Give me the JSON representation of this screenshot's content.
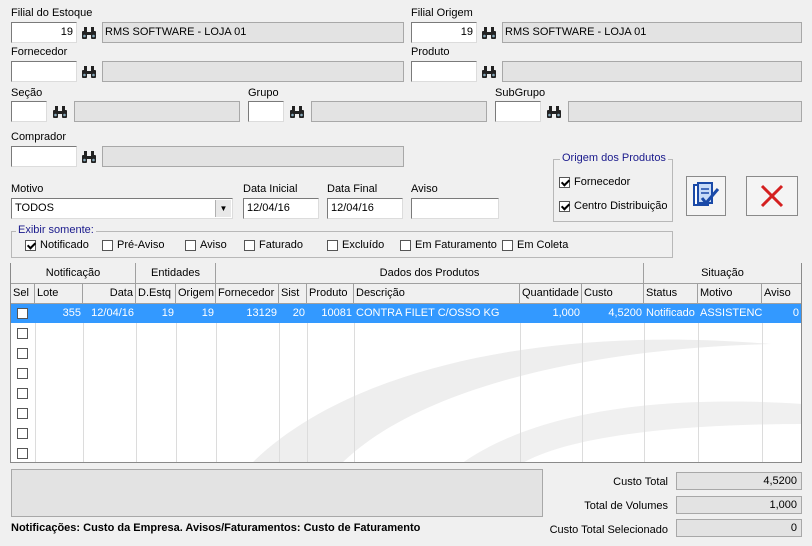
{
  "filial_estoque": {
    "label": "Filial do Estoque",
    "code": "19",
    "name": "RMS SOFTWARE - LOJA 01"
  },
  "filial_origem": {
    "label": "Filial Origem",
    "code": "19",
    "name": "RMS SOFTWARE - LOJA 01"
  },
  "fornecedor": {
    "label": "Fornecedor",
    "code": "",
    "name": ""
  },
  "produto": {
    "label": "Produto",
    "code": "",
    "name": ""
  },
  "secao": {
    "label": "Seção",
    "code": "",
    "name": ""
  },
  "grupo": {
    "label": "Grupo",
    "code": "",
    "name": ""
  },
  "subgrupo": {
    "label": "SubGrupo",
    "code": "",
    "name": ""
  },
  "comprador": {
    "label": "Comprador",
    "code": "",
    "name": ""
  },
  "motivo": {
    "label": "Motivo",
    "value": "TODOS"
  },
  "data_inicial": {
    "label": "Data Inicial",
    "value": "12/04/16"
  },
  "data_final": {
    "label": "Data Final",
    "value": "12/04/16"
  },
  "aviso": {
    "label": "Aviso",
    "value": ""
  },
  "origem_produtos": {
    "title": "Origem dos  Produtos",
    "options": [
      {
        "label": "Fornecedor",
        "checked": true
      },
      {
        "label": "Centro Distribuição",
        "checked": true
      }
    ]
  },
  "exibir": {
    "title": "Exibir somente:",
    "options": [
      {
        "label": "Notificado",
        "checked": true
      },
      {
        "label": "Pré-Aviso",
        "checked": false
      },
      {
        "label": "Aviso",
        "checked": false
      },
      {
        "label": "Faturado",
        "checked": false
      },
      {
        "label": "Excluído",
        "checked": false
      },
      {
        "label": "Em Faturamento",
        "checked": false
      },
      {
        "label": "Em Coleta",
        "checked": false
      }
    ]
  },
  "grid": {
    "groups": [
      "Notificação",
      "Entidades",
      "Dados dos Produtos",
      "Situação"
    ],
    "columns": [
      "Sel",
      "Lote",
      "Data",
      "D.Estq",
      "Origem",
      "Fornecedor",
      "Sist",
      "Produto",
      "Descrição",
      "Quantidade",
      "Custo",
      "Status",
      "Motivo",
      "Aviso"
    ],
    "rows": [
      {
        "lote": "355",
        "data": "12/04/16",
        "destq": "19",
        "origem": "19",
        "fornecedor": "13129",
        "sist": "20",
        "produto": "10081",
        "descricao": "CONTRA FILET C/OSSO KG",
        "quantidade": "1,000",
        "custo": "4,5200",
        "status": "Notificado",
        "motivo": "ASSISTENCIA",
        "aviso": "0"
      }
    ]
  },
  "totals": {
    "custo_total_label": "Custo Total",
    "custo_total": "4,5200",
    "volumes_label": "Total de Volumes",
    "volumes": "1,000",
    "selecionado_label": "Custo Total Selecionado",
    "selecionado": "0"
  },
  "footer_note": "Notificações: Custo da Empresa. Avisos/Faturamentos: Custo de Faturamento",
  "colors": {
    "selection": "#3399ff",
    "danger": "#d42020",
    "group_title": "#1a1a8c"
  }
}
